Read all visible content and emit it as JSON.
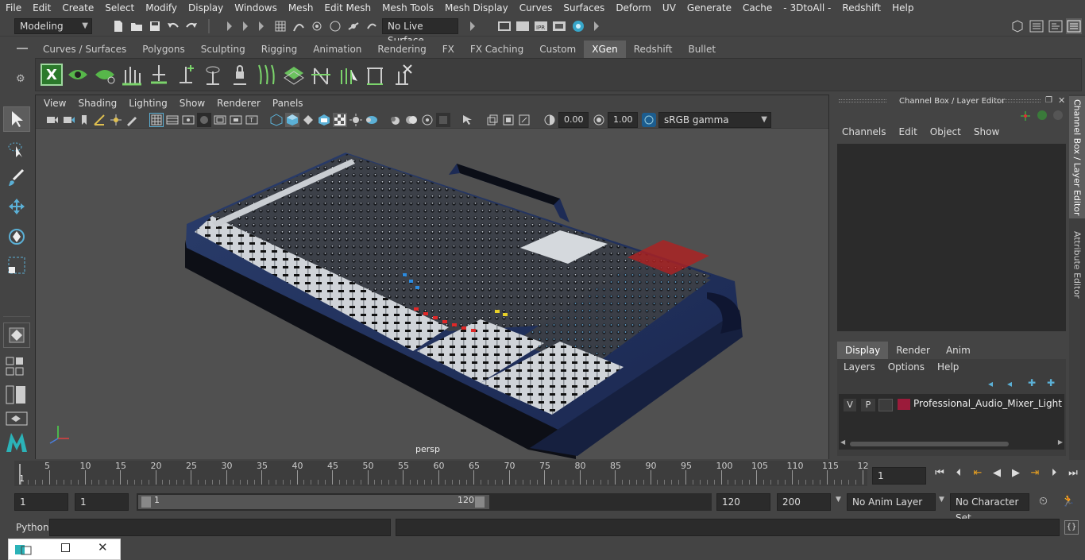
{
  "menus": [
    "File",
    "Edit",
    "Create",
    "Select",
    "Modify",
    "Display",
    "Windows",
    "Mesh",
    "Edit Mesh",
    "Mesh Tools",
    "Mesh Display",
    "Curves",
    "Surfaces",
    "Deform",
    "UV",
    "Generate",
    "Cache",
    "- 3DtoAll -",
    "Redshift",
    "Help"
  ],
  "statusline": {
    "mode": "Modeling",
    "live_surface": "No Live Surface"
  },
  "shelf_tabs": [
    "Curves / Surfaces",
    "Polygons",
    "Sculpting",
    "Rigging",
    "Animation",
    "Rendering",
    "FX",
    "FX Caching",
    "Custom",
    "XGen",
    "Redshift",
    "Bullet"
  ],
  "active_shelf_tab": "XGen",
  "viewport": {
    "menus": [
      "View",
      "Shading",
      "Lighting",
      "Show",
      "Renderer",
      "Panels"
    ],
    "exposure": "0.00",
    "gamma": "1.00",
    "color_space": "sRGB gamma",
    "camera_label": "persp"
  },
  "channel_box": {
    "title": "Channel Box / Layer Editor",
    "menus": [
      "Channels",
      "Edit",
      "Object",
      "Show"
    ],
    "layer_tabs": [
      "Display",
      "Render",
      "Anim"
    ],
    "active_layer_tab": "Display",
    "layer_menus": [
      "Layers",
      "Options",
      "Help"
    ],
    "layer": {
      "v": "V",
      "p": "P",
      "name": "Professional_Audio_Mixer_Light",
      "color": "#9b1b3a"
    }
  },
  "side_tabs": [
    "Channel Box / Layer Editor",
    "Attribute Editor"
  ],
  "timeline": {
    "ticks": [
      "5",
      "10",
      "15",
      "20",
      "25",
      "30",
      "35",
      "40",
      "45",
      "50",
      "55",
      "60",
      "65",
      "70",
      "75",
      "80",
      "85",
      "90",
      "95",
      "100",
      "105",
      "110",
      "115",
      "12"
    ],
    "start_label": "1",
    "current_frame": "1"
  },
  "range": {
    "start": "1",
    "playback_start": "1",
    "slider_start": "1",
    "slider_end": "120",
    "playback_end": "120",
    "end": "200",
    "anim_layer": "No Anim Layer",
    "character_set": "No Character Set"
  },
  "command_line": {
    "label": "Python"
  },
  "colors": {
    "accent": "#5285a6",
    "active_tab": "#5d5d5d"
  }
}
